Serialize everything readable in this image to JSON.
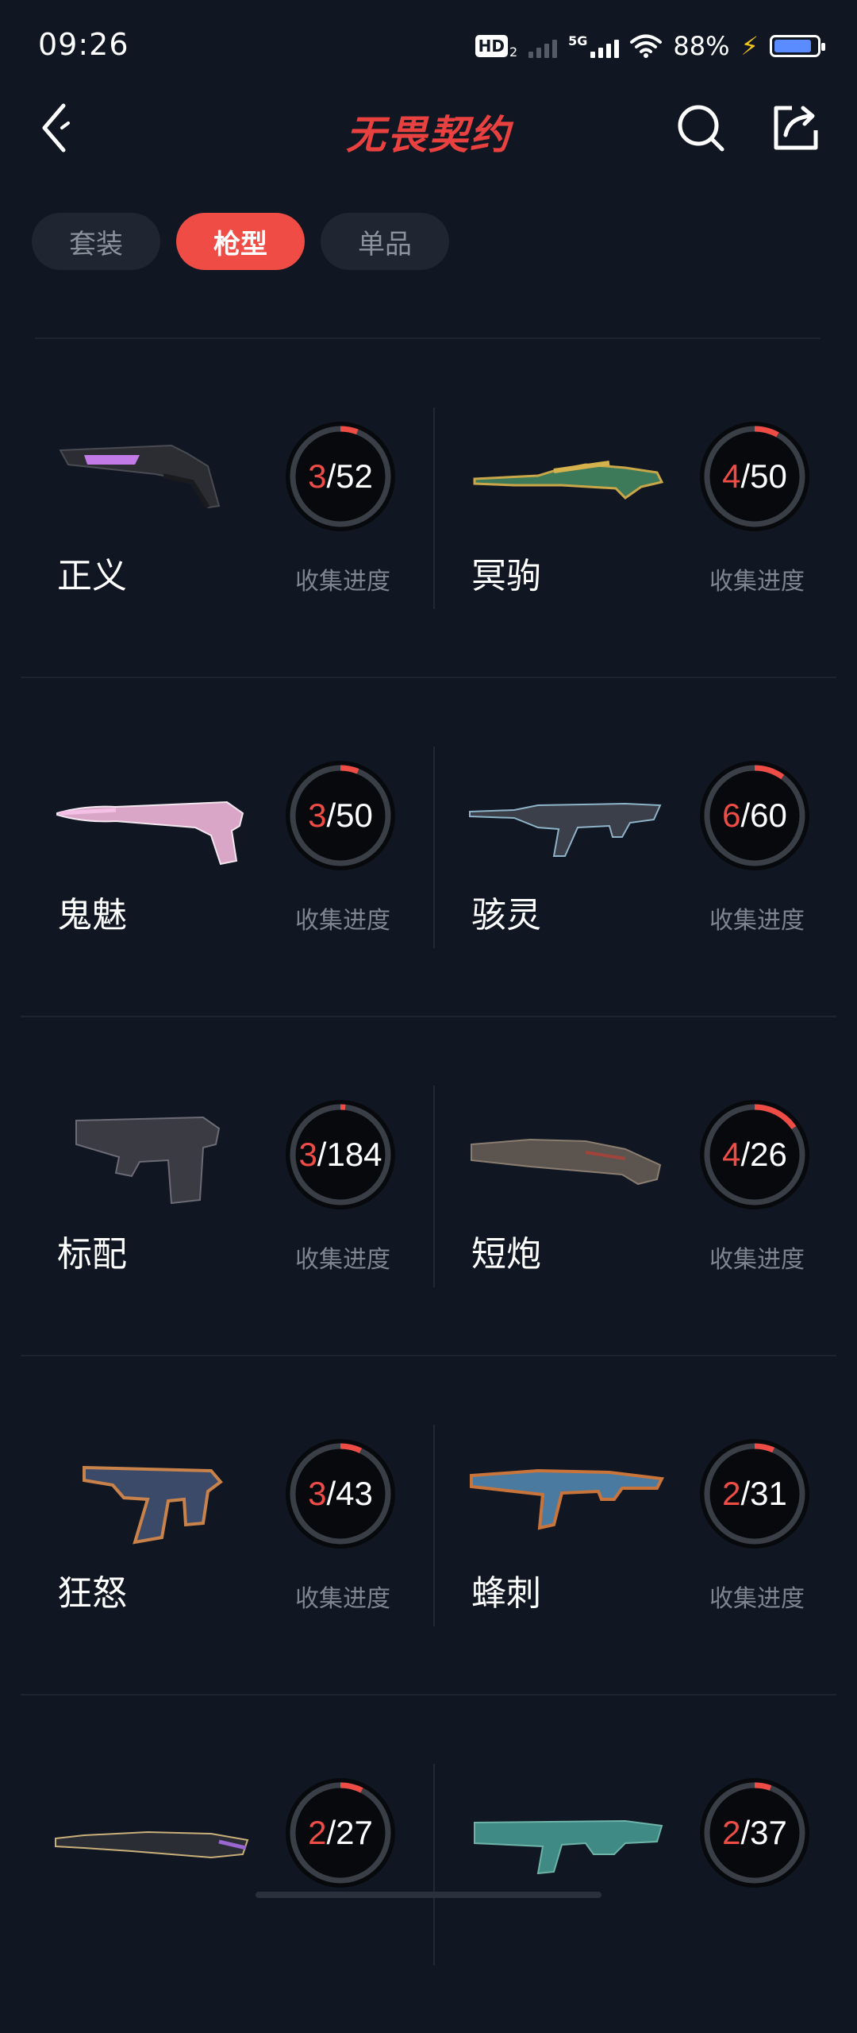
{
  "status_bar": {
    "time": "09:26",
    "hd_label": "HD",
    "hd_sub": "2",
    "network": "5G",
    "battery_percent": "88%",
    "battery_level": 0.88
  },
  "header": {
    "title": "无畏契约",
    "back_icon": "chevron-left-icon",
    "search_icon": "search-icon",
    "share_icon": "share-icon"
  },
  "tabs": [
    {
      "label": "套装",
      "active": false
    },
    {
      "label": "枪型",
      "active": true
    },
    {
      "label": "单品",
      "active": false
    }
  ],
  "colors": {
    "accent": "#ef4c46",
    "background": "#101722",
    "ring_track": "#3a3f47"
  },
  "weapons": [
    {
      "name": "正义",
      "collected": "3",
      "total": "52",
      "label": "收集进度",
      "gun": "revolver"
    },
    {
      "name": "冥驹",
      "collected": "4",
      "total": "50",
      "label": "收集进度",
      "gun": "sniper"
    },
    {
      "name": "鬼魅",
      "collected": "3",
      "total": "50",
      "label": "收集进度",
      "gun": "pistol-long"
    },
    {
      "name": "骇灵",
      "collected": "6",
      "total": "60",
      "label": "收集进度",
      "gun": "rifle"
    },
    {
      "name": "标配",
      "collected": "3",
      "total": "184",
      "label": "收集进度",
      "gun": "pistol"
    },
    {
      "name": "短炮",
      "collected": "4",
      "total": "26",
      "label": "收集进度",
      "gun": "shorty"
    },
    {
      "name": "狂怒",
      "collected": "3",
      "total": "43",
      "label": "收集进度",
      "gun": "frenzy"
    },
    {
      "name": "蜂刺",
      "collected": "2",
      "total": "31",
      "label": "收集进度",
      "gun": "smg"
    },
    {
      "name": "",
      "collected": "2",
      "total": "27",
      "label": "",
      "gun": "shotgun"
    },
    {
      "name": "",
      "collected": "2",
      "total": "37",
      "label": "",
      "gun": "smg2"
    }
  ]
}
